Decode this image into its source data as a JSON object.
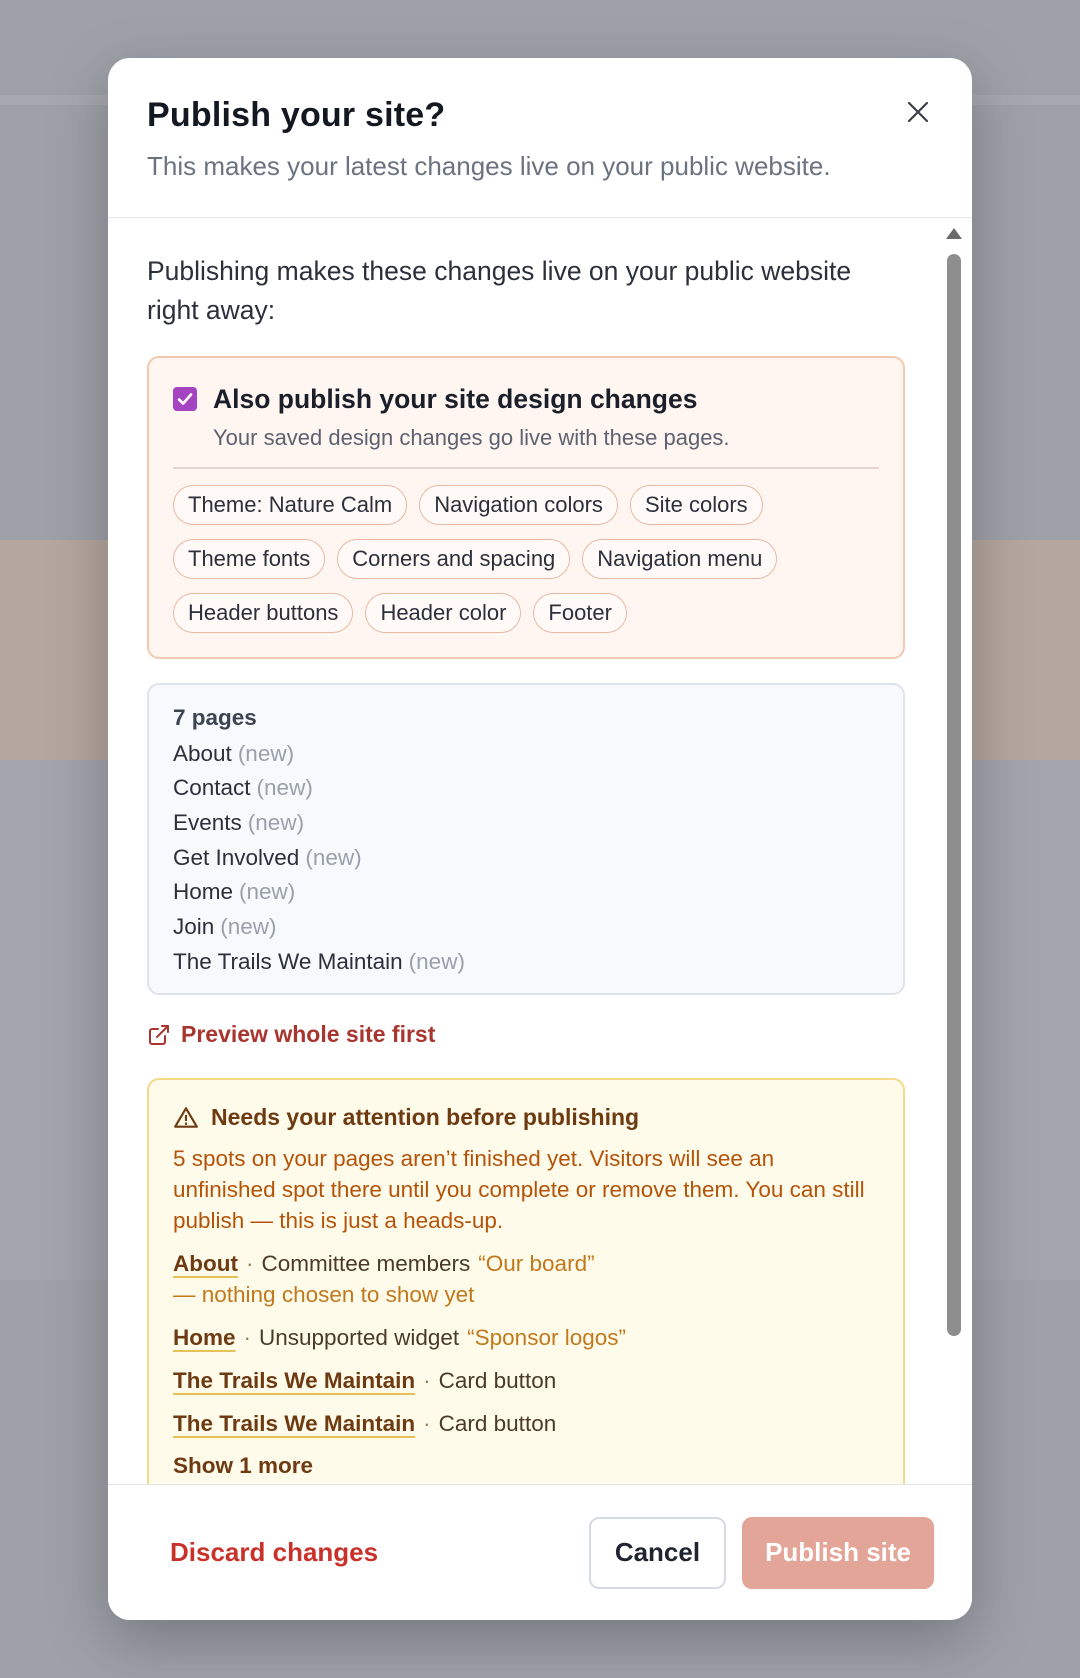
{
  "modal": {
    "title": "Publish your site?",
    "subtitle": "This makes your latest changes live on your public website."
  },
  "intro": "Publishing makes these changes live on your public website right away:",
  "design": {
    "checked": true,
    "title": "Also publish your site design changes",
    "description": "Your saved design changes go live with these pages.",
    "chips": [
      "Theme: Nature Calm",
      "Navigation colors",
      "Site colors",
      "Theme fonts",
      "Corners and spacing",
      "Navigation menu",
      "Header buttons",
      "Header color",
      "Footer"
    ]
  },
  "pages": {
    "count_label": "7 pages",
    "items": [
      {
        "name": "About",
        "tag": "(new)"
      },
      {
        "name": "Contact",
        "tag": "(new)"
      },
      {
        "name": "Events",
        "tag": "(new)"
      },
      {
        "name": "Get Involved",
        "tag": "(new)"
      },
      {
        "name": "Home",
        "tag": "(new)"
      },
      {
        "name": "Join",
        "tag": "(new)"
      },
      {
        "name": "The Trails We Maintain",
        "tag": "(new)"
      }
    ]
  },
  "preview": {
    "label": "Preview whole site first",
    "icon": "external-link-icon"
  },
  "attention": {
    "title": "Needs your attention before publishing",
    "icon": "warning-triangle-icon",
    "text": "5 spots on your pages aren’t finished yet. Visitors will see an unfinished spot there until you complete or remove them. You can still publish — this is just a heads-up.",
    "issues": [
      {
        "page": "About",
        "sep": "·",
        "type": "Committee members",
        "quote": "“Our board”",
        "note": "— nothing chosen to show yet"
      },
      {
        "page": "Home",
        "sep": "·",
        "type": "Unsupported widget",
        "quote": "“Sponsor logos”",
        "note": ""
      },
      {
        "page": "The Trails We Maintain",
        "sep": "·",
        "type": "Card button",
        "quote": "",
        "note": ""
      },
      {
        "page": "The Trails We Maintain",
        "sep": "·",
        "type": "Card button",
        "quote": "",
        "note": ""
      }
    ],
    "show_more": "Show 1 more"
  },
  "footer": {
    "discard": "Discard changes",
    "cancel": "Cancel",
    "publish": "Publish site"
  },
  "colors": {
    "accent_checkbox": "#a544c0",
    "danger": "#c8322b",
    "publish_disabled": "#e3a597",
    "warning_text": "#b45309"
  }
}
